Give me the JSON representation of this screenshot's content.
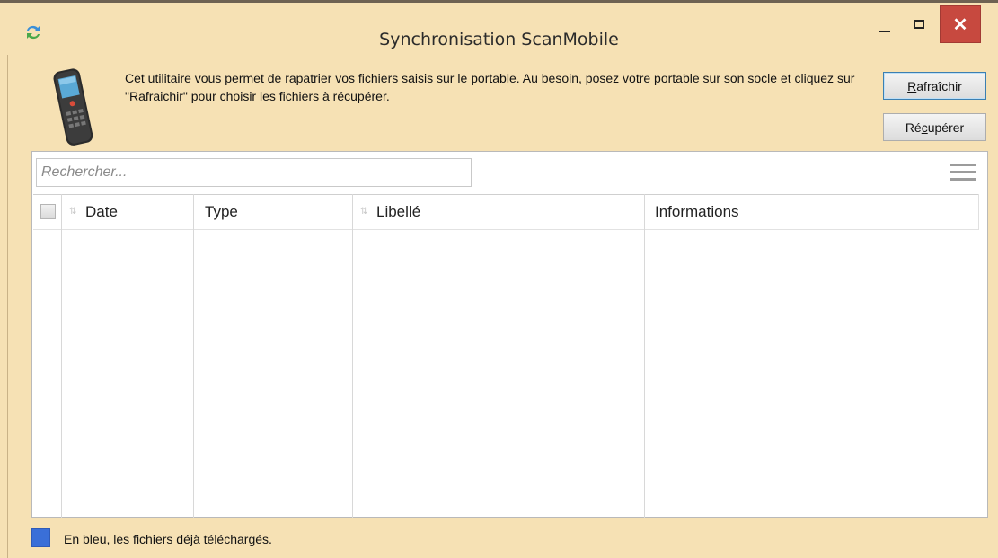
{
  "window": {
    "title": "Synchronisation ScanMobile",
    "close_symbol": "✕",
    "icons": {
      "app": "sync-arrows-icon",
      "device": "handheld-scanner-icon"
    }
  },
  "intro": {
    "text": "Cet utilitaire vous permet de rapatrier vos fichiers saisis sur le portable. Au besoin, posez votre portable sur son socle et cliquez sur \"Rafraichir\" pour choisir les fichiers à récupérer."
  },
  "buttons": {
    "refresh_pre": "",
    "refresh_accel": "R",
    "refresh_post": "afraîchir",
    "retrieve_pre": "Ré",
    "retrieve_accel": "c",
    "retrieve_post": "upérer"
  },
  "search": {
    "placeholder": "Rechercher..."
  },
  "table": {
    "columns": [
      "Date",
      "Type",
      "Libellé",
      "Informations"
    ],
    "rows": []
  },
  "legend": {
    "text": "En bleu, les fichiers déjà téléchargés.",
    "color": "#3a6fd8"
  },
  "colors": {
    "window_bg": "#f6e1b4",
    "close_button": "#c7493f"
  }
}
